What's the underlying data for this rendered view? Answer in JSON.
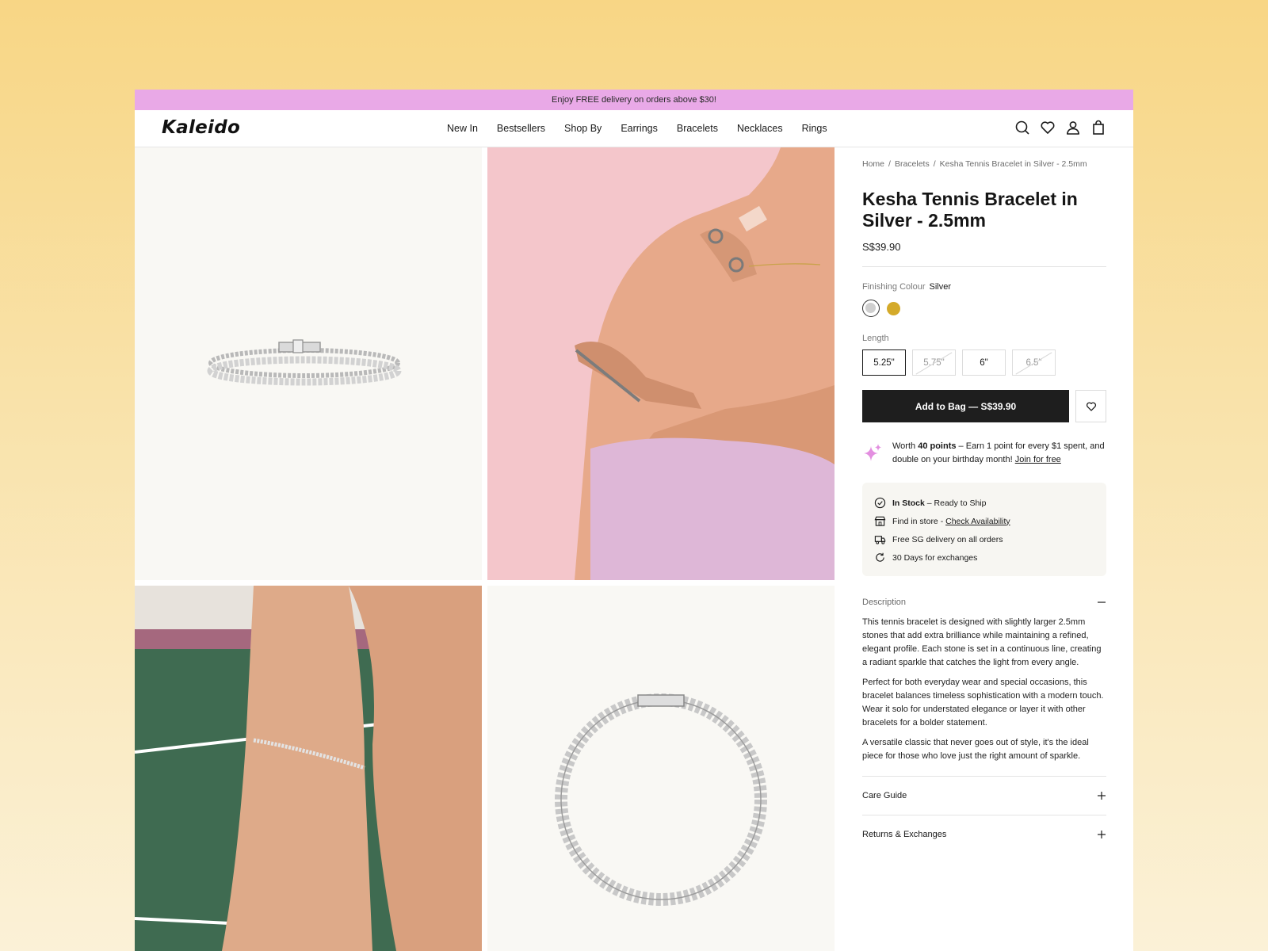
{
  "promo": {
    "text": "Enjoy FREE delivery on orders above $30!"
  },
  "brand": {
    "logo": "Kaleido"
  },
  "nav": {
    "items": [
      "New In",
      "Bestsellers",
      "Shop By",
      "Earrings",
      "Bracelets",
      "Necklaces",
      "Rings"
    ]
  },
  "header_icons": [
    "search-icon",
    "heart-icon",
    "account-icon",
    "bag-icon"
  ],
  "breadcrumb": {
    "home": "Home",
    "sep": "/",
    "category": "Bracelets",
    "current": "Kesha Tennis Bracelet in Silver - 2.5mm"
  },
  "product": {
    "title": "Kesha Tennis Bracelet in Silver - 2.5mm",
    "price": "S$39.90",
    "finishing_label": "Finishing Colour",
    "finishing_value": "Silver",
    "colours": [
      {
        "name": "Silver",
        "hex": "#cfcfcf",
        "selected": true
      },
      {
        "name": "Gold",
        "hex": "#d4aa2a",
        "selected": false
      }
    ],
    "length_label": "Length",
    "lengths": [
      {
        "label": "5.25\"",
        "state": "selected"
      },
      {
        "label": "5.75\"",
        "state": "unavailable"
      },
      {
        "label": "6\"",
        "state": "available"
      },
      {
        "label": "6.5\"",
        "state": "unavailable"
      }
    ],
    "add_to_bag": "Add to Bag — S$39.90"
  },
  "points": {
    "prefix": "Worth ",
    "amount": "40 points",
    "text": " – Earn 1 point for every $1 spent, and double on your birthday month! ",
    "link": "Join for free"
  },
  "stock": {
    "in_stock": "In Stock",
    "ready": " – Ready to Ship",
    "find_store": "Find in store - ",
    "check": "Check Availability",
    "delivery": "Free SG delivery on all orders",
    "exchanges": "30 Days for exchanges"
  },
  "description": {
    "heading": "Description",
    "paragraphs": [
      "This tennis bracelet is designed with slightly larger 2.5mm stones that add extra brilliance while maintaining a refined, elegant profile. Each stone is set in a continuous line, creating a radiant sparkle that catches the light from every angle.",
      "Perfect for both everyday wear and special occasions, this bracelet balances timeless sophistication with a modern touch. Wear it solo for understated elegance or layer it with other bracelets for a bolder statement.",
      "A versatile classic that never goes out of style, it's the ideal piece for those who love just the right amount of sparkle."
    ]
  },
  "accordions": [
    "Care Guide",
    "Returns & Exchanges"
  ],
  "colors": {
    "promo": "#e9a9e7",
    "button": "#1e1e1e",
    "accent": "#e38fe0"
  }
}
